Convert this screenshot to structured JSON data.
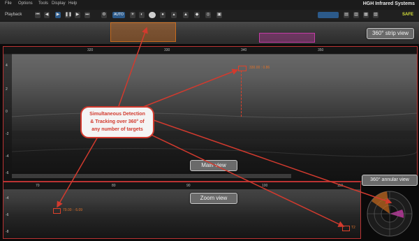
{
  "menubar": {
    "items": [
      "File",
      "Options",
      "Tools",
      "Display",
      "Help"
    ],
    "app_title": "HGH Infrared Systems"
  },
  "toolbar": {
    "playback_label": "Playback",
    "auto_label": "AUTO",
    "status_label": "SAFE"
  },
  "views": {
    "strip_label": "360° strip view",
    "main_label": "Main view",
    "zoom_label": "Zoom view",
    "annular_label": "360° annular view"
  },
  "main_view": {
    "x_ticks": [
      "320",
      "330",
      "340",
      "350"
    ],
    "y_ticks": [
      "4",
      "2",
      "0",
      "-2",
      "-4",
      "-6"
    ],
    "target_text": "330.00 : 0.86"
  },
  "zoom_view": {
    "x_ticks": [
      "70",
      "80",
      "90",
      "100",
      "110"
    ],
    "y_ticks": [
      "-4",
      "-6",
      "-8"
    ],
    "target1_text": "79.00 : -5.09",
    "target2_text": "T2"
  },
  "callout": {
    "lines": [
      "Simultaneous Detection",
      "& Tracking over 360° of",
      "any number of targets"
    ]
  },
  "colors": {
    "accent_red": "#d23a2e",
    "target_orange": "#e0722a",
    "safe_yellow": "#d7e23a"
  }
}
